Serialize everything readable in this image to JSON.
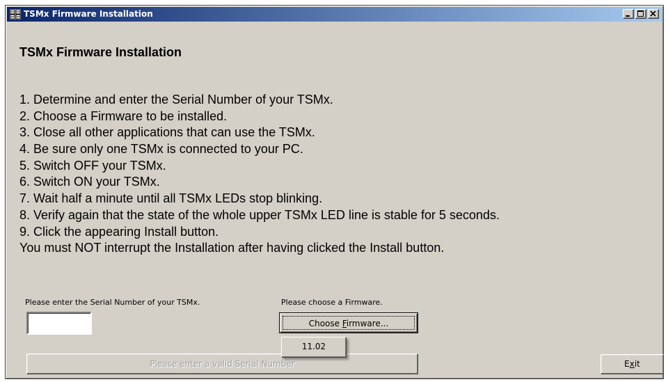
{
  "window": {
    "title": "TSMx Firmware Installation",
    "icon": "app-grid-icon",
    "controls": [
      "minimize-icon",
      "maximize-icon",
      "close-icon"
    ]
  },
  "heading": "TSMx Firmware Installation",
  "instructions": [
    "1. Determine and enter the Serial Number of your TSMx.",
    "2. Choose a Firmware to be installed.",
    "3. Close all other applications that can use the TSMx.",
    "4. Be sure only one TSMx is connected to your PC.",
    "5. Switch OFF your TSMx.",
    "6. Switch ON your TSMx.",
    "7. Wait half a minute until all TSMx LEDs stop blinking.",
    "8. Verify again that the state of the whole upper TSMx LED line is stable for 5 seconds.",
    "9. Click the appearing Install button.",
    "You must NOT interrupt the Installation after having clicked the Install button."
  ],
  "serial": {
    "label": "Please enter the Serial Number of your TSMx.",
    "value": ""
  },
  "firmware": {
    "label": "Please choose a Firmware.",
    "button_before": "Choose ",
    "button_mnemonic": "F",
    "button_after": "irmware...",
    "options": [
      "11.02"
    ]
  },
  "install_button": "Please enter a valid Serial Number",
  "exit_button": {
    "before": "E",
    "mnemonic": "x",
    "after": "it"
  },
  "colors": {
    "face": "#d4d0c8",
    "title_start": "#0a246a",
    "title_end": "#a6caf0",
    "disabled_text": "#a0a0a0"
  }
}
